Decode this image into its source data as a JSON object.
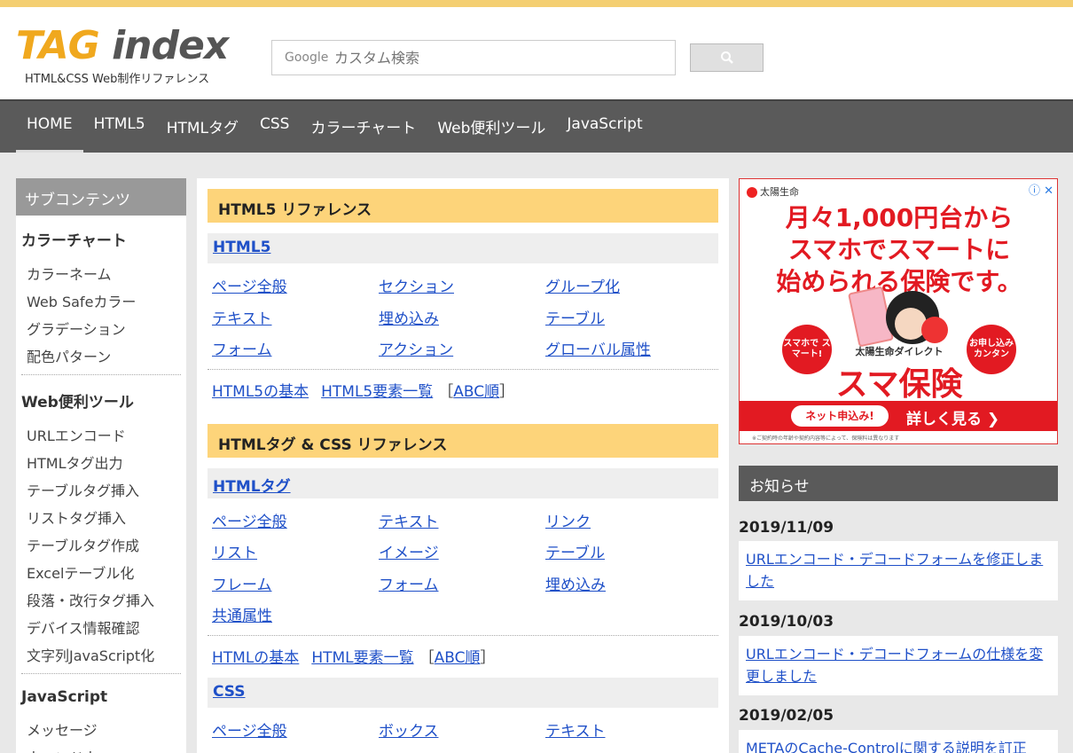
{
  "header": {
    "logo_tag": "TAG",
    "logo_index": " index",
    "logo_sub": "HTML&CSS Web制作リファレンス",
    "search_brand": "Google",
    "search_placeholder": "カスタム検索"
  },
  "nav": [
    "HOME",
    "HTML5",
    "HTMLタグ",
    "CSS",
    "カラーチャート",
    "Web便利ツール",
    "JavaScript"
  ],
  "sidebar": {
    "head": "サブコンテンツ",
    "sections": [
      {
        "title": "カラーチャート",
        "items": [
          "カラーネーム",
          "Web Safeカラー",
          "グラデーション",
          "配色パターン"
        ]
      },
      {
        "title": "Web便利ツール",
        "items": [
          "URLエンコード",
          "HTMLタグ出力",
          "テーブルタグ挿入",
          "リストタグ挿入",
          "テーブルタグ作成",
          "Excelテーブル化",
          "段落・改行タグ挿入",
          "デバイス情報確認",
          "文字列JavaScript化"
        ]
      },
      {
        "title": "JavaScript",
        "items": [
          "メッセージ",
          "ウィンドウ"
        ]
      }
    ]
  },
  "main": {
    "html5_head": "HTML5 リファレンス",
    "html5_sub": "HTML5",
    "html5_links": [
      "ページ全般",
      "セクション",
      "グループ化",
      "テキスト",
      "埋め込み",
      "テーブル",
      "フォーム",
      "アクション",
      "グローバル属性"
    ],
    "html5_foot": {
      "a": "HTML5の基本",
      "b": "HTML5要素一覧",
      "open": "［",
      "c": "ABC順",
      "close": "］"
    },
    "tagcss_head": "HTMLタグ & CSS リファレンス",
    "tag_sub": "HTMLタグ",
    "tag_links": [
      "ページ全般",
      "テキスト",
      "リンク",
      "リスト",
      "イメージ",
      "テーブル",
      "フレーム",
      "フォーム",
      "埋め込み",
      "共通属性"
    ],
    "tag_foot": {
      "a": "HTMLの基本",
      "b": "HTML要素一覧",
      "open": "［",
      "c": "ABC順",
      "close": "］"
    },
    "css_sub": "CSS",
    "css_links": [
      "ページ全般",
      "ボックス",
      "テキスト"
    ]
  },
  "ad": {
    "brand": "太陽生命",
    "line1": "月々1,000円台から",
    "line2": "スマホでスマートに",
    "line3": "始められる保険です。",
    "bubble_left": "スマホで スマート!",
    "bubble_right": "お申し込み カンタン",
    "small": "太陽生命ダイレクト",
    "big": "スマ保険",
    "pill": "ネット申込み!",
    "detail": "詳しく見る ❯",
    "fine": "※ご契約時の年齢や契約内容等によって、保険料は異なります"
  },
  "news": {
    "head": "お知らせ",
    "items": [
      {
        "date": "2019/11/09",
        "text": "URLエンコード・デコードフォームを修正しました"
      },
      {
        "date": "2019/10/03",
        "text": "URLエンコード・デコードフォームの仕様を変更しました"
      },
      {
        "date": "2019/02/05",
        "text": "METAのCache-Controlに関する説明を訂正"
      }
    ]
  }
}
